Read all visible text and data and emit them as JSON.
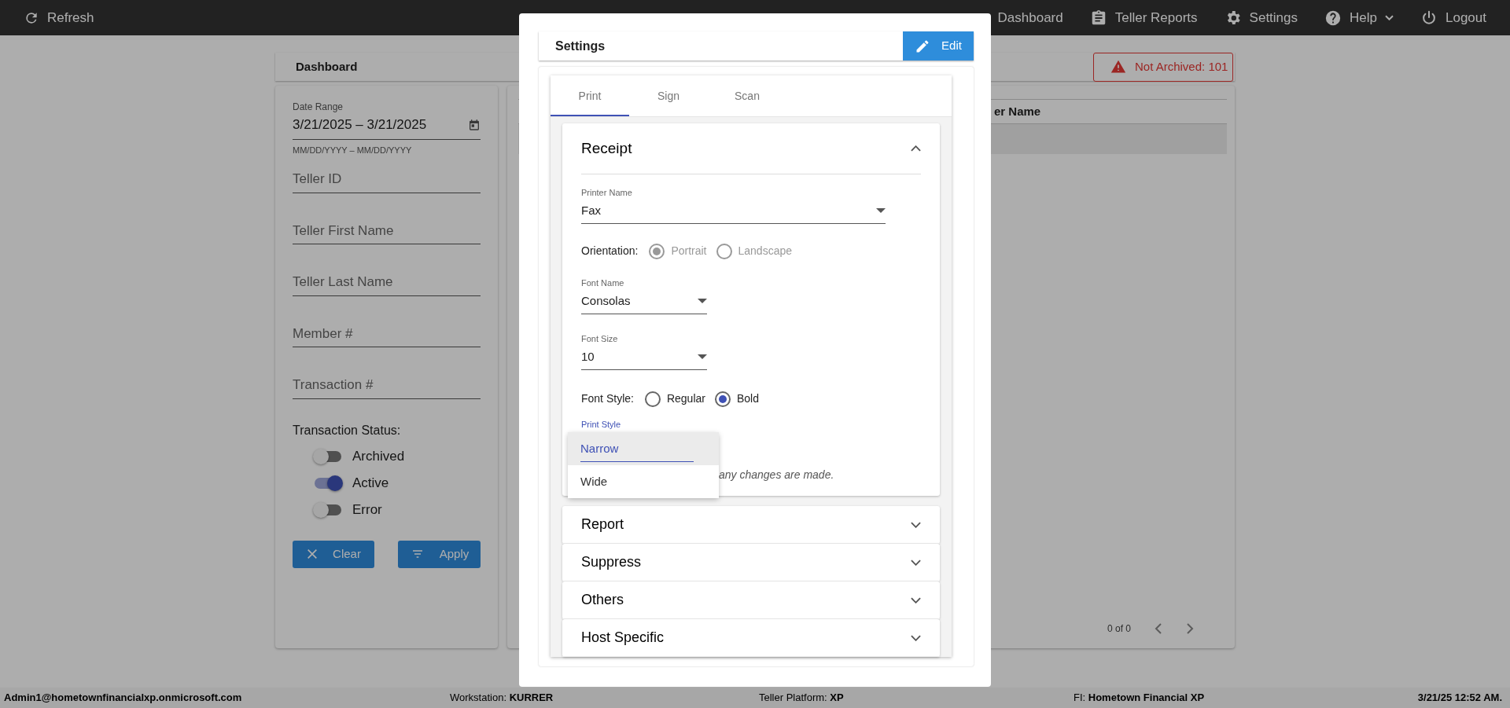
{
  "top_bar": {
    "refresh": "Refresh",
    "nav": [
      {
        "kind": "dashboard",
        "label": "Dashboard"
      },
      {
        "kind": "reports",
        "label": "Teller Reports"
      },
      {
        "kind": "settings",
        "label": "Settings"
      },
      {
        "kind": "help",
        "label": "Help",
        "caret": true
      },
      {
        "kind": "logout",
        "label": "Logout"
      }
    ]
  },
  "dashboard": {
    "title": "Dashboard",
    "alert": "Not Archived: 101"
  },
  "filters": {
    "date_range": {
      "label": "Date Range",
      "value": "3/21/2025 – 3/21/2025",
      "helper": "MM/DD/YYYY – MM/DD/YYYY"
    },
    "fields": [
      {
        "placeholder": "Teller ID"
      },
      {
        "placeholder": "Teller First Name"
      },
      {
        "placeholder": "Teller Last Name"
      },
      {
        "placeholder": "Member #"
      },
      {
        "placeholder": "Transaction #"
      }
    ],
    "status_label": "Transaction Status:",
    "toggles": [
      {
        "label": "Archived",
        "on": false
      },
      {
        "label": "Active",
        "on": true
      },
      {
        "label": "Error",
        "on": false
      }
    ],
    "buttons": [
      {
        "kind": "clear",
        "label": "Clear"
      },
      {
        "kind": "apply",
        "label": "Apply"
      }
    ]
  },
  "table": {
    "columns": [
      "er Name"
    ],
    "pagination": "0 of 0"
  },
  "settings_dialog": {
    "title": "Settings",
    "edit_button": "Edit",
    "tabs": [
      {
        "label": "Print",
        "selected": true
      },
      {
        "label": "Sign",
        "selected": false
      },
      {
        "label": "Scan",
        "selected": false
      }
    ],
    "sections": [
      {
        "title": "Receipt",
        "expanded": true
      },
      {
        "title": "Report",
        "expanded": false
      },
      {
        "title": "Suppress",
        "expanded": false
      },
      {
        "title": "Others",
        "expanded": false
      },
      {
        "title": "Host Specific",
        "expanded": false
      }
    ],
    "receipt": {
      "printer_name": {
        "label": "Printer Name",
        "value": "Fax"
      },
      "orientation": {
        "label": "Orientation:",
        "disabled": true,
        "options": [
          {
            "label": "Portrait",
            "selected": true
          },
          {
            "label": "Landscape",
            "selected": false
          }
        ]
      },
      "font_name": {
        "label": "Font Name",
        "value": "Consolas"
      },
      "font_size": {
        "label": "Font Size",
        "value": "10"
      },
      "font_style": {
        "label": "Font Style:",
        "disabled": false,
        "options": [
          {
            "label": "Regular",
            "selected": false
          },
          {
            "label": "Bold",
            "selected": true
          }
        ]
      },
      "print_style": {
        "label": "Print Style",
        "options": [
          {
            "label": "Narrow",
            "selected": true
          },
          {
            "label": "Wide",
            "selected": false
          }
        ]
      },
      "note": "any changes are made."
    }
  },
  "status_bar": {
    "user": "Admin1@hometownfinancialxp.onmicrosoft.com",
    "items": [
      "Workstation: **KURRER**",
      "Teller Platform: **XP**",
      "FI: **Hometown Financial XP**"
    ],
    "time": "3/21/25 12:52 AM."
  }
}
